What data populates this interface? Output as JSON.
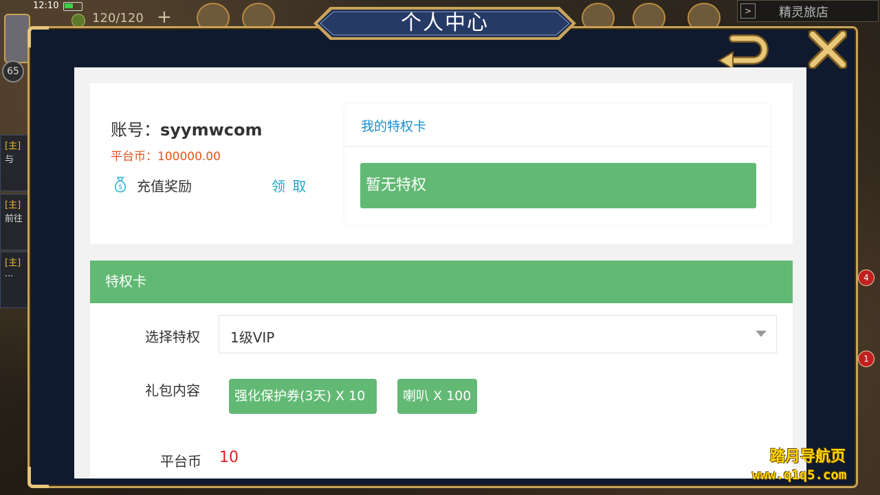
{
  "hud": {
    "clock": "12:10",
    "energy": "120/120",
    "plus_label": "+",
    "level": "65",
    "inn_label": "精灵旅店",
    "inn_arrow": ">"
  },
  "side_quests": [
    {
      "tag": "[主]",
      "text": "与"
    },
    {
      "tag": "[主]",
      "text": "前往"
    },
    {
      "tag": "[主]",
      "text": "..."
    }
  ],
  "badges": [
    "4",
    "1"
  ],
  "modal": {
    "title": "个人中心",
    "back_icon": "back-arrow-icon",
    "close_icon": "close-x-icon"
  },
  "account": {
    "label": "账号：",
    "username": "syymwcom",
    "coin_label": "平台币：",
    "coin_value": "100000.00",
    "reward_icon": "money-bag-icon",
    "reward_label": "充值奖励",
    "claim_label": "领 取"
  },
  "privilege": {
    "title": "我的特权卡",
    "empty_text": "暂无特权"
  },
  "privilege_card": {
    "header": "特权卡",
    "select_label": "选择特权",
    "select_value": "1级VIP",
    "gift_label": "礼包内容",
    "gifts": [
      "强化保护券(3天) X 10",
      "喇叭 X 100"
    ],
    "coin_label": "平台币",
    "coin_value": "10"
  },
  "watermark": {
    "line1": "踏月导航页",
    "line2": "www.q1q5.com"
  },
  "colors": {
    "accent_green": "#62b974",
    "link_blue": "#1f8fc8",
    "coin_orange": "#e0541a",
    "price_red": "#e02020",
    "frame_gold": "#c8a35a",
    "frame_navy": "#0f1a2e"
  }
}
